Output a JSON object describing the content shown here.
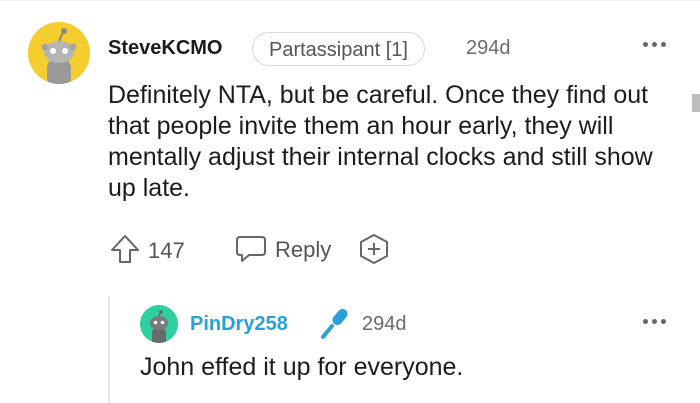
{
  "comment": {
    "username": "SteveKCMO",
    "flair": "Partassipant [1]",
    "age": "294d",
    "body": "Definitely NTA, but be careful. Once they find out that people invite them an hour early, they will mentally adjust their internal clocks and still show up late.",
    "votes": "147",
    "reply_label": "Reply",
    "avatar_color": "#f6cd2e",
    "icons": [
      "upvote-icon",
      "reply-icon",
      "award-icon",
      "more-icon"
    ]
  },
  "reply": {
    "username": "PinDry258",
    "age": "294d",
    "body": "John effed it up for everyone.",
    "avatar_color": "#2ecfa1",
    "username_color": "#2aa0d9",
    "icons": [
      "microphone-icon",
      "more-icon"
    ]
  }
}
